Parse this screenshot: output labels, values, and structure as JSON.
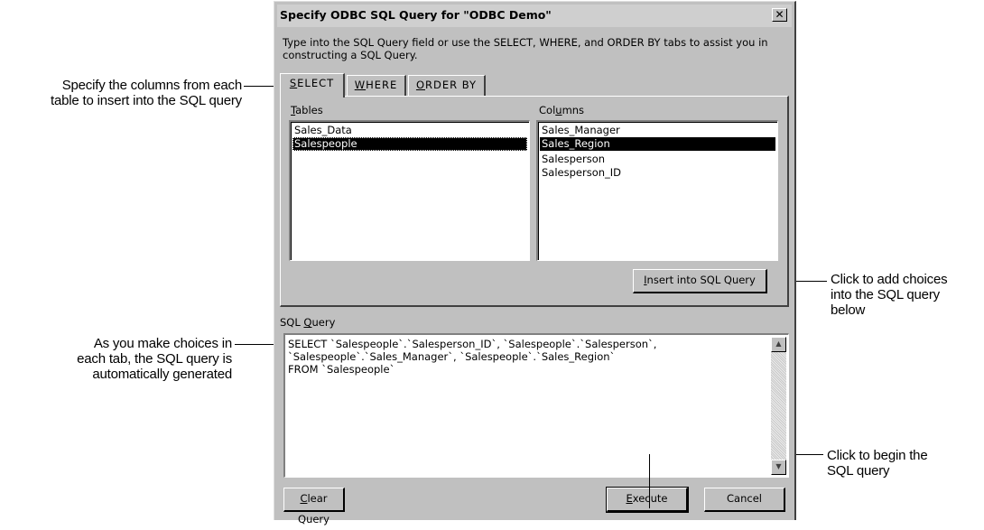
{
  "annotations": {
    "columns_note": [
      "Specify the columns from each",
      "table to insert into the SQL query"
    ],
    "query_note": [
      "As you make choices in",
      "each tab, the SQL query is",
      "automatically generated"
    ],
    "insert_note": [
      "Click to add choices",
      "into the SQL query",
      "below"
    ],
    "execute_note": [
      "Click to begin the",
      "SQL query"
    ]
  },
  "dialog": {
    "title": "Specify ODBC SQL Query for \"ODBC Demo\"",
    "close_glyph": "✕",
    "intro": "Type into the SQL Query field or use the SELECT, WHERE, and ORDER BY tabs to assist you in constructing a SQL Query.",
    "tabs": [
      {
        "key": "S",
        "rest": "ELECT",
        "active": true
      },
      {
        "key": "W",
        "rest": "HERE",
        "active": false
      },
      {
        "key": "O",
        "rest": "RDER BY",
        "active": false
      }
    ],
    "tables_label": {
      "key": "T",
      "rest": "ables"
    },
    "columns_label": {
      "pre": "Col",
      "key": "u",
      "rest": "mns"
    },
    "tables": [
      "Sales_Data",
      "Salespeople"
    ],
    "tables_selected": 1,
    "columns": [
      "Sales_Manager",
      "Sales_Region",
      "Salesperson",
      "Salesperson_ID"
    ],
    "columns_selected": 1,
    "insert_button": {
      "key": "I",
      "rest": "nsert into SQL Query"
    },
    "sql_label": {
      "pre": "SQL ",
      "key": "Q",
      "rest": "uery"
    },
    "sql_lines": [
      "SELECT `Salespeople`.`Salesperson_ID`, `Salespeople`.`Salesperson`,",
      "`Salespeople`.`Sales_Manager`, `Salespeople`.`Sales_Region`",
      "FROM `Salespeople`"
    ],
    "clear_button": {
      "key": "C",
      "rest": "lear Query"
    },
    "execute_button": {
      "key": "E",
      "rest": "xecute"
    },
    "cancel_button": "Cancel",
    "scroll_up_glyph": "▲",
    "scroll_down_glyph": "▼"
  },
  "colors": {
    "dialog_face": "#c0c0c0",
    "titlebar": "#cfcfcf",
    "selection": "#000000",
    "selection_text": "#ffffff"
  }
}
